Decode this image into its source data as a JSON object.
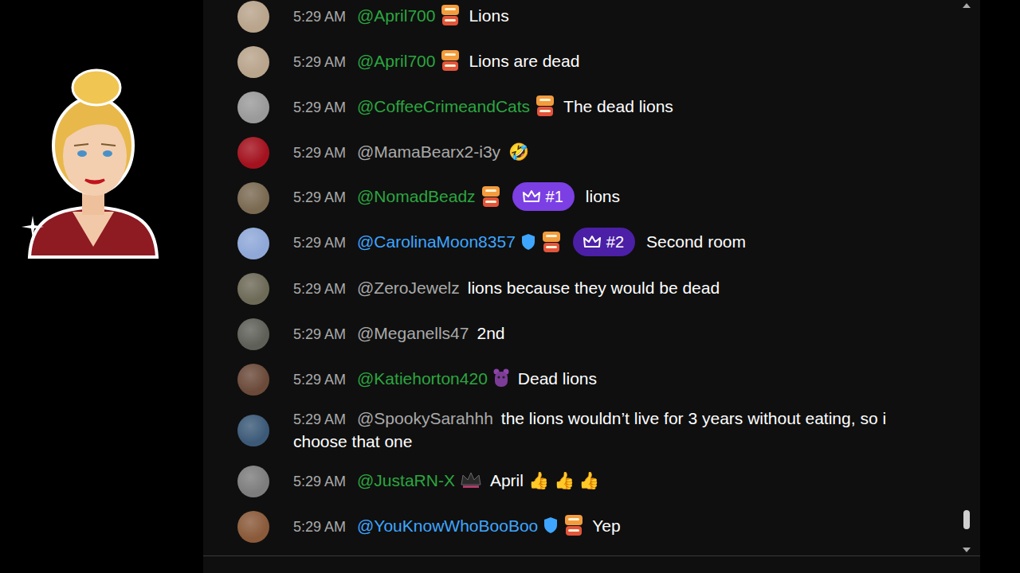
{
  "chat": {
    "messages": [
      {
        "time": "5:29 AM",
        "user": {
          "name": "@April700",
          "color": "#2ba640"
        },
        "avatar": {
          "color": "#b9a48c"
        },
        "badges": [
          {
            "kind": "wat"
          }
        ],
        "rank": null,
        "text": "Lions"
      },
      {
        "time": "5:29 AM",
        "user": {
          "name": "@April700",
          "color": "#2ba640"
        },
        "avatar": {
          "color": "#b9a48c"
        },
        "badges": [
          {
            "kind": "wat"
          }
        ],
        "rank": null,
        "text": "Lions are dead"
      },
      {
        "time": "5:29 AM",
        "user": {
          "name": "@CoffeeCrimeandCats",
          "color": "#2ba640"
        },
        "avatar": {
          "color": "#9a9a9a"
        },
        "badges": [
          {
            "kind": "wat"
          }
        ],
        "rank": null,
        "text": "The dead lions"
      },
      {
        "time": "5:29 AM",
        "user": {
          "name": "@MamaBearx2-i3y",
          "color": "#aaaaaa"
        },
        "avatar": {
          "color": "#a3121e"
        },
        "badges": [],
        "rank": null,
        "text": "🤣"
      },
      {
        "time": "5:29 AM",
        "user": {
          "name": "@NomadBeadz",
          "color": "#2ba640"
        },
        "avatar": {
          "color": "#7a6a52"
        },
        "badges": [
          {
            "kind": "wat"
          }
        ],
        "rank": {
          "text": "#1",
          "color": "#7b3fe4"
        },
        "text": "lions"
      },
      {
        "time": "5:29 AM",
        "user": {
          "name": "@CarolinaMoon8357",
          "color": "#3ea6ff"
        },
        "avatar": {
          "color": "#8fa8d8"
        },
        "badges": [
          {
            "kind": "shield"
          },
          {
            "kind": "wat"
          }
        ],
        "rank": {
          "text": "#2",
          "color": "#4b1fa6"
        },
        "text": "Second room"
      },
      {
        "time": "5:29 AM",
        "user": {
          "name": "@ZeroJewelz",
          "color": "#aaaaaa"
        },
        "avatar": {
          "color": "#6e6a58"
        },
        "badges": [],
        "rank": null,
        "text": "lions because they would be dead"
      },
      {
        "time": "5:29 AM",
        "user": {
          "name": "@Meganells47",
          "color": "#aaaaaa"
        },
        "avatar": {
          "color": "#5e6058"
        },
        "badges": [],
        "rank": null,
        "text": "2nd"
      },
      {
        "time": "5:29 AM",
        "user": {
          "name": "@Katiehorton420",
          "color": "#2ba640"
        },
        "avatar": {
          "color": "#6b4a3a"
        },
        "badges": [
          {
            "kind": "purple"
          }
        ],
        "rank": null,
        "text": "Dead lions"
      },
      {
        "time": "5:29 AM",
        "user": {
          "name": "@SpookySarahhh",
          "color": "#aaaaaa"
        },
        "avatar": {
          "color": "#3c5a78"
        },
        "badges": [],
        "rank": null,
        "text": "the lions wouldn’t live for 3 years without eating, so i choose that one"
      },
      {
        "time": "5:29 AM",
        "user": {
          "name": "@JustaRN-X",
          "color": "#2ba640"
        },
        "avatar": {
          "color": "#7d7d7d"
        },
        "badges": [
          {
            "kind": "crown"
          }
        ],
        "rank": null,
        "text": "April 👍 👍 👍"
      },
      {
        "time": "5:29 AM",
        "user": {
          "name": "@YouKnowWhoBooBoo",
          "color": "#3ea6ff"
        },
        "avatar": {
          "color": "#8a5a3a"
        },
        "badges": [
          {
            "kind": "shield"
          },
          {
            "kind": "wat"
          }
        ],
        "rank": null,
        "text": "Yep"
      }
    ]
  },
  "scrollbar": {
    "level": 0.97
  }
}
